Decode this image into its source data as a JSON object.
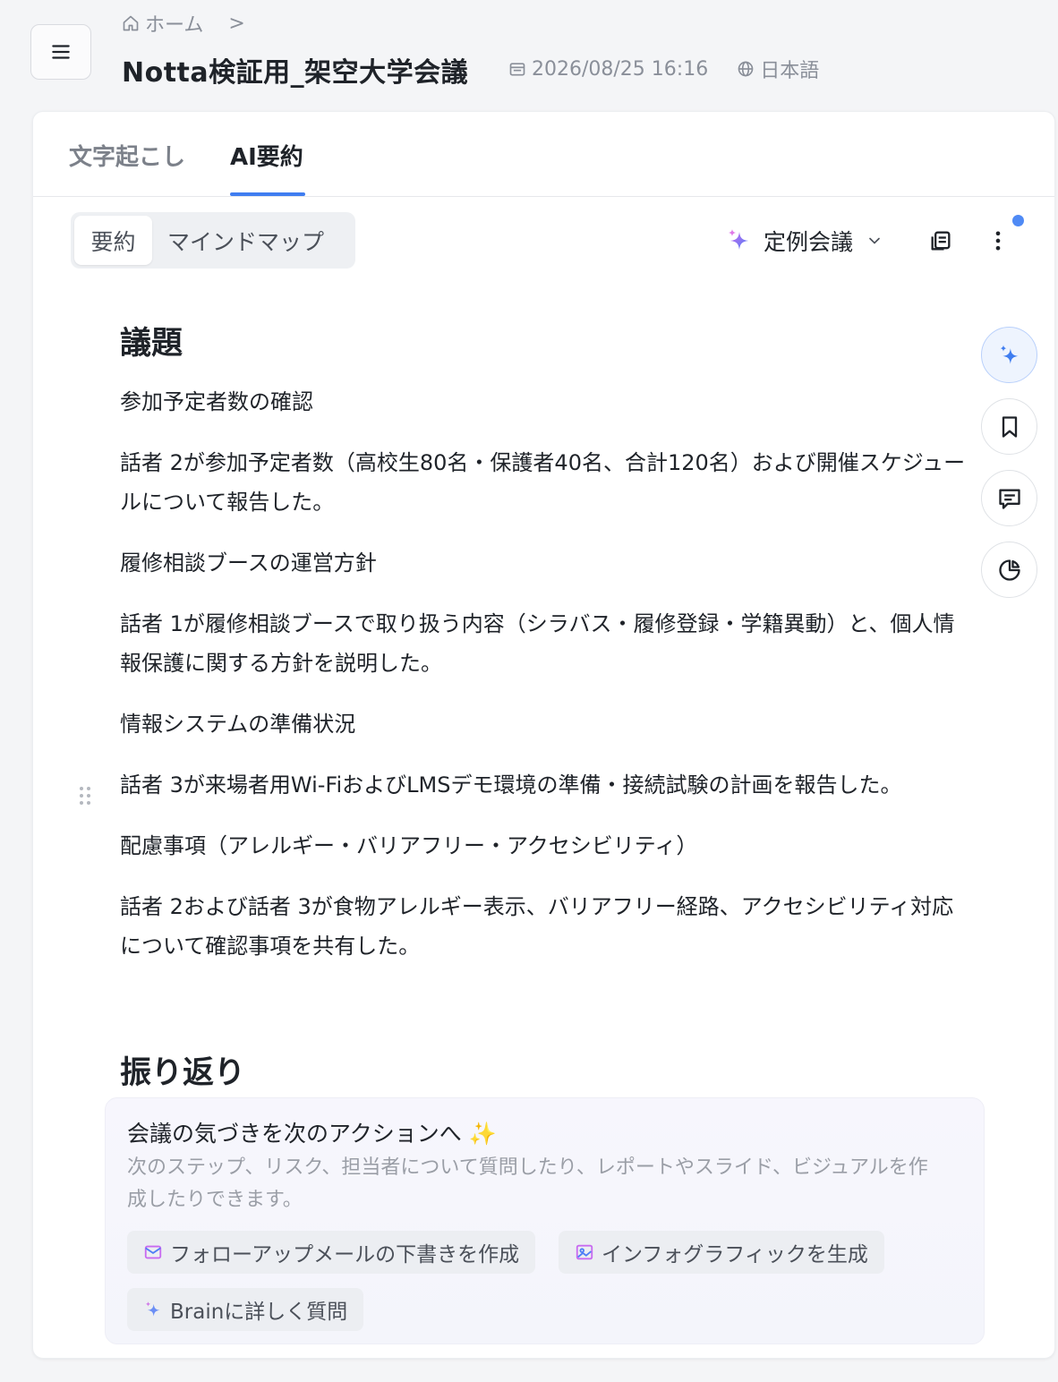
{
  "breadcrumb": {
    "home": "ホーム",
    "separator": ">"
  },
  "header": {
    "title": "Notta検証用_架空大学会議",
    "datetime": "2026/08/25 16:16",
    "language": "日本語"
  },
  "tabs": [
    {
      "label": "文字起こし",
      "active": false
    },
    {
      "label": "AI要約",
      "active": true
    }
  ],
  "view_toggle": [
    {
      "label": "要約",
      "active": true
    },
    {
      "label": "マインドマップ",
      "active": false
    }
  ],
  "toolbar": {
    "template_label": "定例会議",
    "accent": "#3f7df0"
  },
  "summary": {
    "heading_agenda": "議題",
    "items": [
      {
        "topic": "参加予定者数の確認",
        "detail": "話者 2が参加予定者数（高校生80名・保護者40名、合計120名）および開催スケジュールについて報告した。"
      },
      {
        "topic": "履修相談ブースの運営方針",
        "detail": "話者 1が履修相談ブースで取り扱う内容（シラバス・履修登録・学籍異動）と、個人情報保護に関する方針を説明した。"
      },
      {
        "topic": "情報システムの準備状況",
        "detail": "話者 3が来場者用Wi-FiおよびLMSデモ環境の準備・接続試験の計画を報告した。"
      },
      {
        "topic": "配慮事項（アレルギー・バリアフリー・アクセシビリティ）",
        "detail": "話者 2および話者 3が食物アレルギー表示、バリアフリー経路、アクセシビリティ対応について確認事項を共有した。"
      }
    ],
    "heading_review": "振り返り"
  },
  "brain_panel": {
    "title": "会議の気づきを次のアクションへ ✨",
    "description": "次のステップ、リスク、担当者について質問したり、レポートやスライド、ビジュアルを作成したりできます。",
    "chips": [
      {
        "label": "フォローアップメールの下書きを作成",
        "icon": "mail-icon"
      },
      {
        "label": "インフォグラフィックを生成",
        "icon": "image-icon"
      },
      {
        "label": "Brainに詳しく質問",
        "icon": "sparkle-icon"
      }
    ]
  }
}
